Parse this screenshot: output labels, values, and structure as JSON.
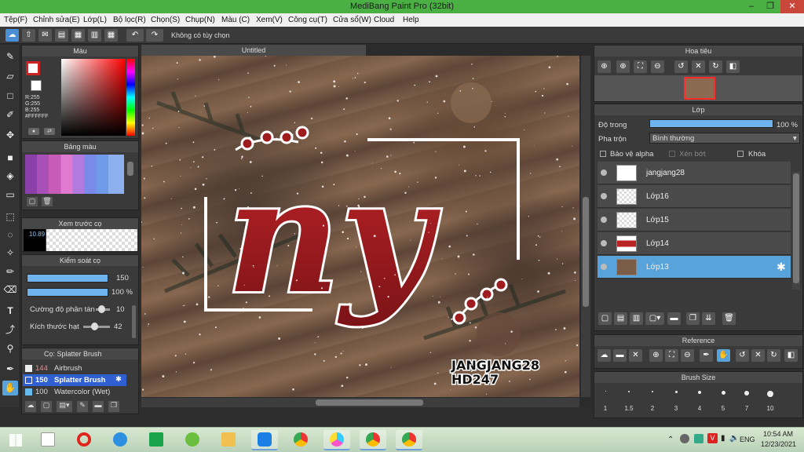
{
  "window": {
    "title": "MediBang Paint Pro (32bit)",
    "minimize": "–",
    "restore": "❐",
    "close": "✕"
  },
  "menu": [
    "Tệp(F)",
    "Chỉnh sửa(E)",
    "Lớp(L)",
    "Bộ lọc(R)",
    "Chọn(S)",
    "Chụp(N)",
    "Màu (C)",
    "Xem(V)",
    "Công cụ(T)",
    "Cửa sổ(W)",
    "Cloud",
    "Help"
  ],
  "toolbar": {
    "no_selection": "Không có tùy chọn",
    "undo": "↶",
    "redo": "↷"
  },
  "color_panel": {
    "title": "Màu",
    "r": "R:255",
    "g": "G:255",
    "b": "B:255",
    "hex": "#FFFFFF"
  },
  "palette_panel": {
    "title": "Bảng màu"
  },
  "brush_preview_panel": {
    "title": "Xem trước cọ",
    "size": "10.89"
  },
  "brush_control_panel": {
    "title": "Kiểm soát cọ",
    "size_value": "150",
    "opacity_value": "100 %",
    "scatter_label": "Cường độ phân tán",
    "scatter_value": "10",
    "particle_label": "Kích thước hạt",
    "particle_value": "42"
  },
  "brush_list_panel": {
    "title": "Cọ: Splatter Brush",
    "items": [
      {
        "size": "144",
        "name": "Airbrush",
        "color": "#eeeeee"
      },
      {
        "size": "150",
        "name": "Splatter Brush",
        "color": "#2f5fd0"
      },
      {
        "size": "100",
        "name": "Watercolor (Wet)",
        "color": "#66bbee"
      }
    ]
  },
  "document": {
    "tab": "Untitled",
    "art_text": "ny",
    "signature_line1": "JANGJANG28",
    "signature_line2": "HD247"
  },
  "navigator_panel": {
    "title": "Hoa tiêu"
  },
  "layer_panel": {
    "title": "Lớp",
    "opacity_label": "Độ trong",
    "opacity_value": "100 %",
    "opacity_level": 1.0,
    "blend_label": "Pha trộn",
    "blend_value": "Bình thường",
    "protect_alpha": "Bảo vệ alpha",
    "clipping": "Xén bớt",
    "lock": "Khóa",
    "layers": [
      {
        "name": "jangjang28",
        "selected": false
      },
      {
        "name": "Lớp16",
        "selected": false
      },
      {
        "name": "Lớp15",
        "selected": false
      },
      {
        "name": "Lớp14",
        "selected": false
      },
      {
        "name": "Lớp13",
        "selected": true
      }
    ]
  },
  "reference_panel": {
    "title": "Reference"
  },
  "brush_size_panel": {
    "title": "Brush Size",
    "sizes": [
      "1",
      "1.5",
      "2",
      "3",
      "4",
      "5",
      "7",
      "10"
    ]
  },
  "taskbar": {
    "language": "ENG",
    "time": "10:54 AM",
    "date": "12/23/2021"
  },
  "colors": {
    "accent": "#58a3da",
    "titlebar": "#4bb044",
    "art_red": "#9e1b1e"
  }
}
